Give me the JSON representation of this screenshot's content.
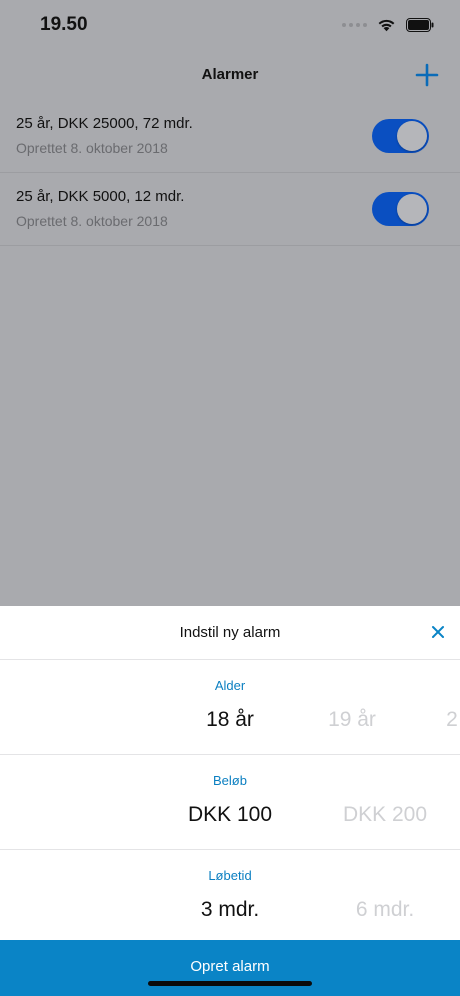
{
  "status_bar": {
    "time": "19.50"
  },
  "nav": {
    "title": "Alarmer",
    "add_icon": "plus-icon"
  },
  "alarms": [
    {
      "title": "25 år, DKK 25000, 72 mdr.",
      "created": "Oprettet 8. oktober 2018",
      "enabled": true
    },
    {
      "title": "25 år, DKK 5000, 12 mdr.",
      "created": "Oprettet 8. oktober 2018",
      "enabled": true
    }
  ],
  "sheet": {
    "title": "Indstil ny alarm",
    "close_icon": "close-icon",
    "pickers": {
      "age": {
        "label": "Alder",
        "options": [
          "18 år",
          "19 år",
          "2"
        ]
      },
      "amount": {
        "label": "Beløb",
        "options": [
          "DKK 100",
          "DKK 200"
        ]
      },
      "duration": {
        "label": "Løbetid",
        "options": [
          "3 mdr.",
          "6 mdr."
        ]
      }
    },
    "submit_label": "Opret alarm"
  },
  "colors": {
    "accent": "#0a84c6",
    "label_accent": "#0b7fc1",
    "toggle_on": "#0a4fc1",
    "dim_background": "#a9aaae"
  }
}
